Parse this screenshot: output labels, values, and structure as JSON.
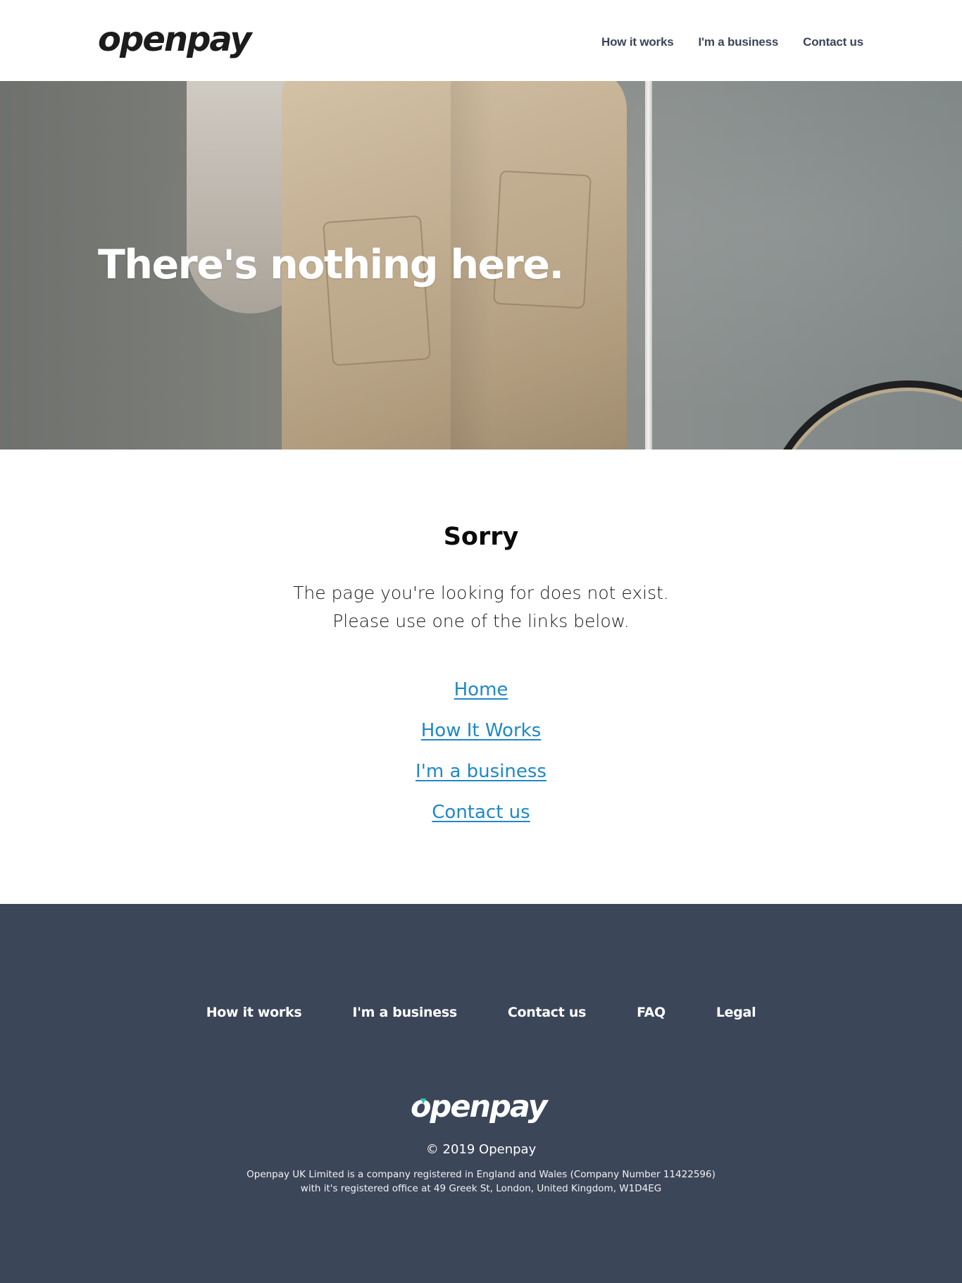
{
  "header": {
    "logo_text": "openpay",
    "nav": [
      {
        "label": "How it works"
      },
      {
        "label": "I'm a business"
      },
      {
        "label": "Contact us"
      }
    ]
  },
  "hero": {
    "title": "There's nothing here."
  },
  "main": {
    "heading": "Sorry",
    "message_line1": "The page you're looking for does not exist.",
    "message_line2": "Please use one of the links below.",
    "links": [
      {
        "label": "Home"
      },
      {
        "label": "How It Works"
      },
      {
        "label": "I'm a business"
      },
      {
        "label": "Contact us"
      }
    ]
  },
  "footer": {
    "nav": [
      {
        "label": "How it works"
      },
      {
        "label": "I'm a business"
      },
      {
        "label": "Contact us"
      },
      {
        "label": "FAQ"
      },
      {
        "label": "Legal"
      }
    ],
    "logo_text": "openpay",
    "copyright": "© 2019 Openpay",
    "legal_line1": "Openpay UK Limited is a company registered in England and Wales (Company Number 11422596)",
    "legal_line2": "with it's registered office at 49 Greek St, London, United Kingdom, W1D4EG"
  },
  "colors": {
    "nav_text": "#3b4559",
    "link": "#1f88c7",
    "footer_bg": "#3c4659",
    "logo_accent": "#22c7a9"
  }
}
